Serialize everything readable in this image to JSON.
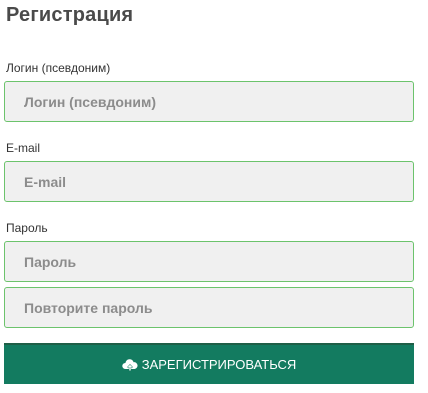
{
  "form": {
    "title": "Регистрация",
    "login": {
      "label": "Логин (псевдоним)",
      "placeholder": "Логин (псевдоним)",
      "value": ""
    },
    "email": {
      "label": "E-mail",
      "placeholder": "E-mail",
      "value": ""
    },
    "password": {
      "label": "Пароль",
      "placeholder": "Пароль",
      "value": ""
    },
    "password_repeat": {
      "placeholder": "Повторите пароль",
      "value": ""
    },
    "submit": {
      "label": "ЗАРЕГИСТРИРОВАТЬСЯ",
      "icon": "cloud-upload-icon"
    }
  },
  "colors": {
    "field_border": "#6cc36c",
    "field_background": "#f0f0f0",
    "button_background": "#137b60",
    "title_color": "#4a4a4a"
  }
}
